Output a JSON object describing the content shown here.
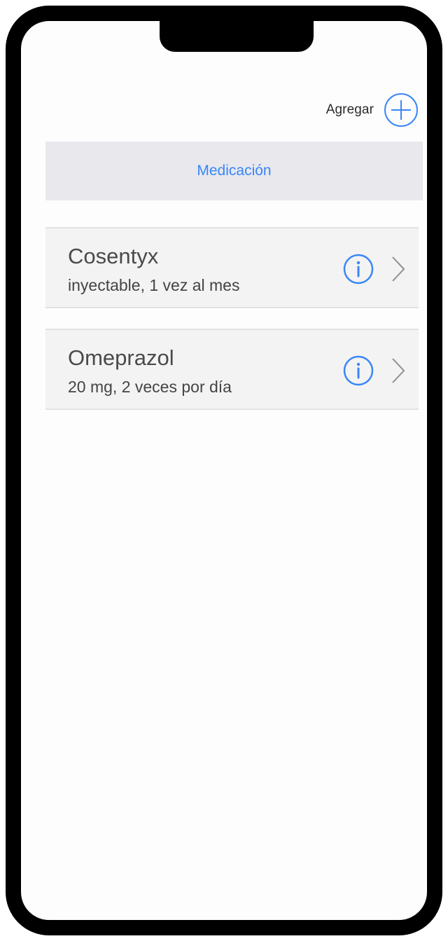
{
  "header": {
    "add_label": "Agregar"
  },
  "section": {
    "title": "Medicación"
  },
  "medications": [
    {
      "name": "Cosentyx",
      "detail": "inyectable, 1 vez al mes"
    },
    {
      "name": "Omeprazol",
      "detail": "20 mg, 2 veces por día"
    }
  ],
  "colors": {
    "accent": "#3a86f7",
    "header_background": "#e8e8ed",
    "row_background": "#f3f3f3",
    "frame": "#000000"
  },
  "icons": {
    "add": "plus-circle-icon",
    "info": "info-circle-icon",
    "chevron": "chevron-right-icon"
  }
}
